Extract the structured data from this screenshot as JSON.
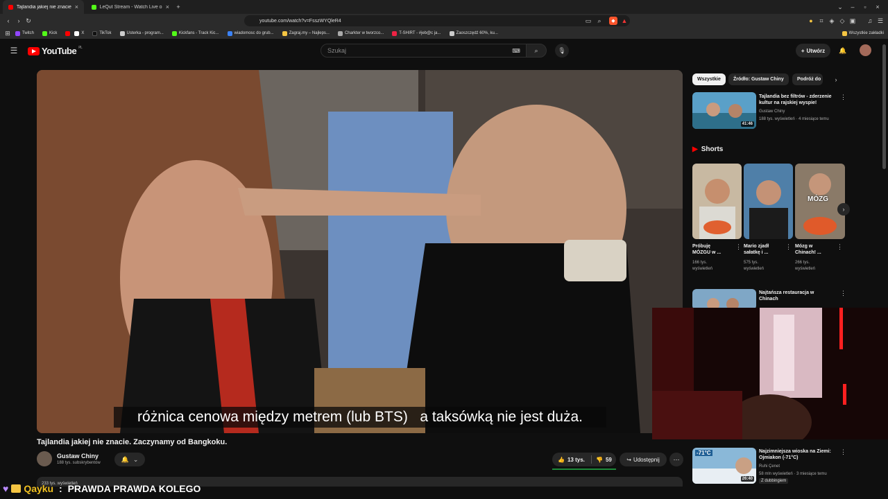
{
  "browser": {
    "tabs": [
      {
        "label": "Tajlandia jakiej nie znacie. Za",
        "active": true
      },
      {
        "label": "LeQut Stream - Watch Live on Kick",
        "active": false
      }
    ],
    "url": "youtube.com/watch?v=FsszWYQleR4",
    "bookmarks": [
      {
        "label": "Twitch",
        "color": "#9146ff"
      },
      {
        "label": "Kick",
        "color": "#53fc18"
      },
      {
        "label": "",
        "color": "#ff0000"
      },
      {
        "label": "X",
        "color": "#ffffff"
      },
      {
        "label": "TikTok",
        "color": "#111111"
      },
      {
        "label": "Usterka - program...",
        "color": "#cccccc"
      },
      {
        "label": "Kickfans - Track Kic...",
        "color": "#53fc18"
      },
      {
        "label": "wiadomosc do grub...",
        "color": "#3b82f6"
      },
      {
        "label": "Zagraj.my – Najleps...",
        "color": "#f5c542"
      },
      {
        "label": "Charkter w tworzco...",
        "color": "#aaaaaa"
      },
      {
        "label": "T-SHIRT - #jeb@c ja...",
        "color": "#e24"
      },
      {
        "label": "Zaoszczędź 60%, ku...",
        "color": "#cccccc"
      }
    ],
    "bookmarks_right": "Wszystkie zakładki"
  },
  "yt": {
    "logo": "YouTube",
    "logo_region": "PL",
    "search_placeholder": "Szukaj",
    "create": "Utwórz",
    "subtitle": "różnica cenowa między metrem (lub BTS)   a taksówką nie jest duża.",
    "video_title": "Tajlandia jakiej nie znacie. Zaczynamy od Bangkoku.",
    "channel": "Gustaw Chiny",
    "subs": "188 tys. subskrybentów",
    "likes": "13 tys.",
    "dislikes": "59",
    "share": "Udostępnij",
    "desc_peek": "233 tys. wyświetleń"
  },
  "sidebar": {
    "chips": [
      "Wszystkie",
      "Źródło: Gustaw Chiny",
      "Podróż do"
    ],
    "rec1": {
      "title1": "Tajlandia bez filtrów - zderzenie",
      "title2": "kultur na rajskiej wyspie!",
      "channel": "Gustaw Chiny",
      "meta": "188 tys. wyświetleń · 4 miesiące temu",
      "duration": "41:46"
    },
    "shorts_label": "Shorts",
    "shorts": [
      {
        "t1": "Próbuję",
        "t2": "MÓZGU w ...",
        "m1": "166 tys.",
        "m2": "wyświetleń"
      },
      {
        "t1": "Mario zjadł",
        "t2": "sałatkę i ...",
        "m1": "575 tys.",
        "m2": "wyświetleń"
      },
      {
        "t1": "Mózg w",
        "t2": "Chinach! ...",
        "m1": "266 tys.",
        "m2": "wyświetleń",
        "overlay": "MÓZG"
      }
    ],
    "rec2": {
      "title1": "Najtańsza restauracja w",
      "title2": "Chinach"
    },
    "rec3": {
      "title1": "Najzimniejsza wioska na Ziemi:",
      "title2": "Ojmiakon (-71°C)",
      "channel": "Ruhi Çenet",
      "meta": "58 mln wyświetleń · 3 miesiące temu",
      "badge": "Z dubbingiem",
      "duration": "26:40",
      "thumb_text": "-71°C"
    }
  },
  "chat": {
    "user": "Qayku",
    "sep": " : ",
    "message": "PRAWDA PRAWDA KOLEGO"
  }
}
